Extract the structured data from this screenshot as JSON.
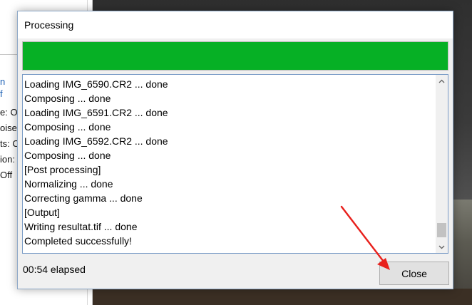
{
  "background": {
    "left_panel_lines": [
      {
        "text": "n",
        "color": "blue"
      },
      {
        "text": "f",
        "color": "blue"
      },
      {
        "text": "e: O",
        "color": "black"
      },
      {
        "text": "oise",
        "color": "black"
      },
      {
        "text": "ts: C",
        "color": "black"
      },
      {
        "text": "ion:",
        "color": "black"
      },
      {
        "text": "Off",
        "color": "black"
      }
    ]
  },
  "dialog": {
    "title": "Processing",
    "progress": 1.0,
    "progress_color": "#06b025",
    "log_lines": [
      "Loading IMG_6590.CR2 ... done",
      "Composing ... done",
      "Loading IMG_6591.CR2 ... done",
      "Composing ... done",
      "Loading IMG_6592.CR2 ... done",
      "Composing ... done",
      "[Post processing]",
      "Normalizing ... done",
      "Correcting gamma ... done",
      "[Output]",
      "Writing resultat.tif ... done",
      "Completed successfully!"
    ],
    "elapsed": "00:54 elapsed",
    "close_label": "Close"
  },
  "annotation": {
    "type": "arrow",
    "color": "#e8201c"
  }
}
